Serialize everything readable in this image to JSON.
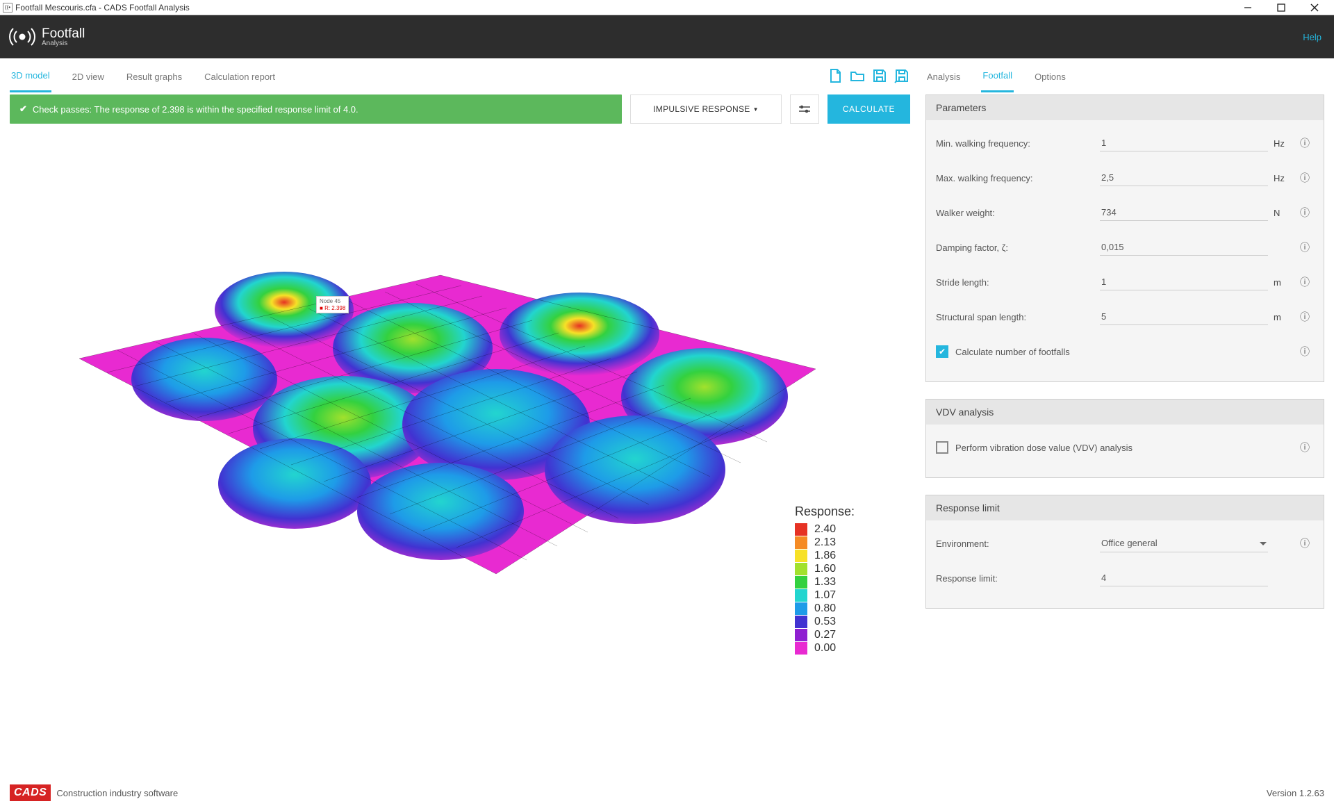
{
  "window": {
    "title": "Footfall Mescouris.cfa - CADS Footfall Analysis"
  },
  "header": {
    "app_name": "Footfall",
    "app_sub": "Analysis",
    "help": "Help"
  },
  "left_tabs": [
    "3D model",
    "2D view",
    "Result graphs",
    "Calculation report"
  ],
  "left_active_tab": 0,
  "status_text": "Check passes: The response of 2.398 is within the specified response limit of 4.0.",
  "dropdown_label": "IMPULSIVE RESPONSE",
  "calculate_label": "CALCULATE",
  "tooltip": {
    "line1": "Node 45",
    "line2": "R: 2.398"
  },
  "legend": {
    "title": "Response:",
    "items": [
      {
        "c": "#e63224",
        "v": "2.40"
      },
      {
        "c": "#f58b24",
        "v": "2.13"
      },
      {
        "c": "#f7e127",
        "v": "1.86"
      },
      {
        "c": "#a2e12d",
        "v": "1.60"
      },
      {
        "c": "#33d13f",
        "v": "1.33"
      },
      {
        "c": "#22d5cf",
        "v": "1.07"
      },
      {
        "c": "#1e9be8",
        "v": "0.80"
      },
      {
        "c": "#4132d1",
        "v": "0.53"
      },
      {
        "c": "#8f1fd1",
        "v": "0.27"
      },
      {
        "c": "#e82ad1",
        "v": "0.00"
      }
    ]
  },
  "right_tabs": [
    "Analysis",
    "Footfall",
    "Options"
  ],
  "right_active_tab": 1,
  "parameters": {
    "title": "Parameters",
    "fields": [
      {
        "label": "Min. walking frequency:",
        "value": "1",
        "unit": "Hz"
      },
      {
        "label": "Max. walking frequency:",
        "value": "2,5",
        "unit": "Hz"
      },
      {
        "label": "Walker weight:",
        "value": "734",
        "unit": "N"
      },
      {
        "label": "Damping factor, ζ:",
        "value": "0,015",
        "unit": ""
      },
      {
        "label": "Stride length:",
        "value": "1",
        "unit": "m"
      },
      {
        "label": "Structural span length:",
        "value": "5",
        "unit": "m"
      }
    ],
    "checkbox_label": "Calculate number of footfalls",
    "checkbox_on": true
  },
  "vdv": {
    "title": "VDV analysis",
    "checkbox_label": "Perform vibration dose value (VDV) analysis",
    "checkbox_on": false
  },
  "response_limit": {
    "title": "Response limit",
    "env_label": "Environment:",
    "env_value": "Office general",
    "rl_label": "Response limit:",
    "rl_value": "4"
  },
  "footer": {
    "tagline": "Construction industry software",
    "version": "Version 1.2.63"
  },
  "chart_data": {
    "type": "heatmap",
    "title": "Response:",
    "colorscale": [
      {
        "value": 0.0,
        "color": "#e82ad1"
      },
      {
        "value": 0.27,
        "color": "#8f1fd1"
      },
      {
        "value": 0.53,
        "color": "#4132d1"
      },
      {
        "value": 0.8,
        "color": "#1e9be8"
      },
      {
        "value": 1.07,
        "color": "#22d5cf"
      },
      {
        "value": 1.33,
        "color": "#33d13f"
      },
      {
        "value": 1.6,
        "color": "#a2e12d"
      },
      {
        "value": 1.86,
        "color": "#f7e127"
      },
      {
        "value": 2.13,
        "color": "#f58b24"
      },
      {
        "value": 2.4,
        "color": "#e63224"
      }
    ],
    "range": [
      0.0,
      2.4
    ],
    "peak_node": {
      "id": 45,
      "value": 2.398
    },
    "note": "3D contour surface showing footfall response factor across the floor plate; peak ≈2.40 near one corner, zero nodes along mid-spans."
  }
}
